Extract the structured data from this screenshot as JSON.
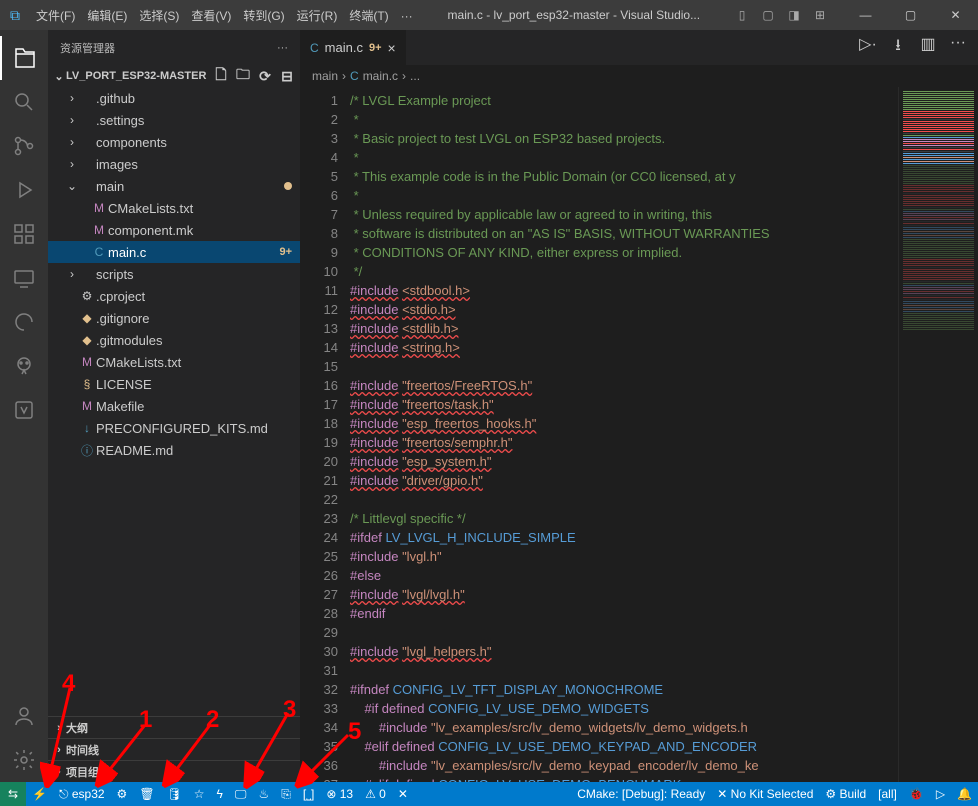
{
  "window": {
    "title": "main.c - lv_port_esp32-master - Visual Studio..."
  },
  "menu": [
    "文件(F)",
    "编辑(E)",
    "选择(S)",
    "查看(V)",
    "转到(G)",
    "运行(R)",
    "终端(T)",
    "···"
  ],
  "sidebar": {
    "header": "资源管理器",
    "project": "LV_PORT_ESP32-MASTER",
    "tree": [
      {
        "type": "folder",
        "name": ".github",
        "depth": 1
      },
      {
        "type": "folder",
        "name": ".settings",
        "depth": 1
      },
      {
        "type": "folder",
        "name": "components",
        "depth": 1
      },
      {
        "type": "folder",
        "name": "images",
        "depth": 1
      },
      {
        "type": "folder",
        "name": "main",
        "depth": 1,
        "open": true,
        "modified": true
      },
      {
        "type": "file",
        "name": "CMakeLists.txt",
        "depth": 2,
        "icon": "M",
        "iconClass": "m-color"
      },
      {
        "type": "file",
        "name": "component.mk",
        "depth": 2,
        "icon": "M",
        "iconClass": "m-color"
      },
      {
        "type": "file",
        "name": "main.c",
        "depth": 2,
        "icon": "C",
        "iconClass": "c-color",
        "active": true,
        "git": "9+"
      },
      {
        "type": "folder",
        "name": "scripts",
        "depth": 1
      },
      {
        "type": "file",
        "name": ".cproject",
        "depth": 1,
        "icon": "⚙",
        "iconClass": ""
      },
      {
        "type": "file",
        "name": ".gitignore",
        "depth": 1,
        "icon": "◆",
        "iconClass": "y-color"
      },
      {
        "type": "file",
        "name": ".gitmodules",
        "depth": 1,
        "icon": "◆",
        "iconClass": "y-color"
      },
      {
        "type": "file",
        "name": "CMakeLists.txt",
        "depth": 1,
        "icon": "M",
        "iconClass": "m-color"
      },
      {
        "type": "file",
        "name": "LICENSE",
        "depth": 1,
        "icon": "§",
        "iconClass": "y-color"
      },
      {
        "type": "file",
        "name": "Makefile",
        "depth": 1,
        "icon": "M",
        "iconClass": "m-color"
      },
      {
        "type": "file",
        "name": "PRECONFIGURED_KITS.md",
        "depth": 1,
        "icon": "↓",
        "iconClass": "blue-color"
      },
      {
        "type": "file",
        "name": "README.md",
        "depth": 1,
        "icon": "ⓘ",
        "iconClass": "blue-color"
      }
    ],
    "outline": "大纲",
    "timeline": "时间线",
    "projectGroup": "项目组件"
  },
  "tab": {
    "icon": "C",
    "name": "main.c",
    "mod": "9+"
  },
  "breadcrumb": [
    "main",
    "C",
    "main.c",
    "..."
  ],
  "code_lines": [
    {
      "n": 1,
      "html": "<span class='cm'>/* LVGL Example project</span>"
    },
    {
      "n": 2,
      "html": "<span class='cm'> *</span>"
    },
    {
      "n": 3,
      "html": "<span class='cm'> * Basic project to test LVGL on ESP32 based projects.</span>"
    },
    {
      "n": 4,
      "html": "<span class='cm'> *</span>"
    },
    {
      "n": 5,
      "html": "<span class='cm'> * This example code is in the Public Domain (or CC0 licensed, at y</span>"
    },
    {
      "n": 6,
      "html": "<span class='cm'> *</span>"
    },
    {
      "n": 7,
      "html": "<span class='cm'> * Unless required by applicable law or agreed to in writing, this</span>"
    },
    {
      "n": 8,
      "html": "<span class='cm'> * software is distributed on an \"AS IS\" BASIS, WITHOUT WARRANTIES </span>"
    },
    {
      "n": 9,
      "html": "<span class='cm'> * CONDITIONS OF ANY KIND, either express or implied.</span>"
    },
    {
      "n": 10,
      "html": "<span class='cm'> */</span>"
    },
    {
      "n": 11,
      "html": "<span class='kw inc'>#include</span> <span class='str inc'>&lt;stdbool.h&gt;</span>"
    },
    {
      "n": 12,
      "html": "<span class='kw inc'>#include</span> <span class='str inc'>&lt;stdio.h&gt;</span>"
    },
    {
      "n": 13,
      "html": "<span class='kw inc'>#include</span> <span class='str inc'>&lt;stdlib.h&gt;</span>"
    },
    {
      "n": 14,
      "html": "<span class='kw inc'>#include</span> <span class='str inc'>&lt;string.h&gt;</span>"
    },
    {
      "n": 15,
      "html": ""
    },
    {
      "n": 16,
      "html": "<span class='kw inc'>#include</span> <span class='str inc'>\"freertos/FreeRTOS.h\"</span>"
    },
    {
      "n": 17,
      "html": "<span class='kw inc'>#include</span> <span class='str inc'>\"freertos/task.h\"</span>"
    },
    {
      "n": 18,
      "html": "<span class='kw inc'>#include</span> <span class='str inc'>\"esp_freertos_hooks.h\"</span>"
    },
    {
      "n": 19,
      "html": "<span class='kw inc'>#include</span> <span class='str inc'>\"freertos/semphr.h\"</span>"
    },
    {
      "n": 20,
      "html": "<span class='kw inc'>#include</span> <span class='str inc'>\"esp_system.h\"</span>"
    },
    {
      "n": 21,
      "html": "<span class='kw inc'>#include</span> <span class='str inc'>\"driver/gpio.h\"</span>"
    },
    {
      "n": 22,
      "html": ""
    },
    {
      "n": 23,
      "html": "<span class='cm'>/* Littlevgl specific */</span>"
    },
    {
      "n": 24,
      "html": "<span class='kw'>#ifdef</span> <span class='def'>LV_LVGL_H_INCLUDE_SIMPLE</span>"
    },
    {
      "n": 25,
      "html": "<span class='kw'>#include</span> <span class='str'>\"lvgl.h\"</span>"
    },
    {
      "n": 26,
      "html": "<span class='kw'>#else</span>"
    },
    {
      "n": 27,
      "html": "<span class='kw inc'>#include</span> <span class='str inc'>\"lvgl/lvgl.h\"</span>"
    },
    {
      "n": 28,
      "html": "<span class='kw'>#endif</span>"
    },
    {
      "n": 29,
      "html": ""
    },
    {
      "n": 30,
      "html": "<span class='kw inc'>#include</span> <span class='str inc'>\"lvgl_helpers.h\"</span>"
    },
    {
      "n": 31,
      "html": ""
    },
    {
      "n": 32,
      "html": "<span class='kw'>#ifndef</span> <span class='def'>CONFIG_LV_TFT_DISPLAY_MONOCHROME</span>"
    },
    {
      "n": 33,
      "html": "    <span class='kw'>#if defined</span> <span class='def'>CONFIG_LV_USE_DEMO_WIDGETS</span>"
    },
    {
      "n": 34,
      "html": "        <span class='kw'>#include</span> <span class='str'>\"lv_examples/src/lv_demo_widgets/lv_demo_widgets.h</span>"
    },
    {
      "n": 35,
      "html": "    <span class='kw'>#elif defined</span> <span class='def'>CONFIG_LV_USE_DEMO_KEYPAD_AND_ENCODER</span>"
    },
    {
      "n": 36,
      "html": "        <span class='kw'>#include</span> <span class='str'>\"lv_examples/src/lv_demo_keypad_encoder/lv_demo_ke</span>"
    },
    {
      "n": 37,
      "html": "    <span class='kw'>#elif defined</span> <span class='def'>CONFIG_LV_USE_DEMO_BENCHMARK</span>"
    }
  ],
  "statusbar": {
    "esp32": "⎋ esp32",
    "errors": "⊗ 13",
    "warnings": "⚠ 0",
    "cmake": "CMake: [Debug]: Ready",
    "nokit": "✕ No Kit Selected",
    "build": "⚙ Build",
    "all": "[all]"
  },
  "annotations": {
    "1": "1",
    "2": "2",
    "3": "3",
    "4": "4",
    "5": "5"
  }
}
